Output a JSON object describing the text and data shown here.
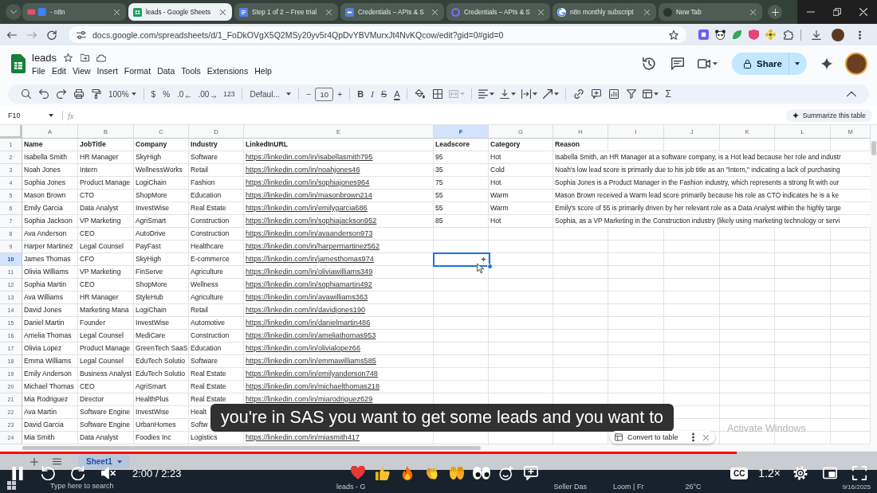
{
  "browser": {
    "tabs": [
      {
        "title": "- n8n",
        "kind": "n8n",
        "selected": false
      },
      {
        "title": "leads - Google Sheets",
        "kind": "sheets",
        "selected": true
      },
      {
        "title": "Step 1 of 2 – Free trial",
        "kind": "page",
        "selected": false
      },
      {
        "title": "Credentials – APIs & S",
        "kind": "api",
        "selected": false
      },
      {
        "title": "Credentials – APIs & S",
        "kind": "ring",
        "selected": false
      },
      {
        "title": "n8n monthly subscript",
        "kind": "google",
        "selected": false
      },
      {
        "title": "New Tab",
        "kind": "blank",
        "selected": false
      }
    ],
    "url": "docs.google.com/spreadsheets/d/1_FoDkOVgX5Q2MSy20yv5r4QpDvYBVMurxJt4NvKQcow/edit?gid=0#gid=0"
  },
  "sheets_header": {
    "title": "leads",
    "menu": [
      "File",
      "Edit",
      "View",
      "Insert",
      "Format",
      "Data",
      "Tools",
      "Extensions",
      "Help"
    ],
    "share": "Share"
  },
  "toolbar": {
    "zoom": "100%",
    "currency": "$",
    "percent": "%",
    "decrease_decimals": ".0",
    "increase_decimals": ".00",
    "number_format": "123",
    "font": "Defaul...",
    "decrease_size": "−",
    "font_size": "10",
    "increase_size": "+",
    "bold": "B",
    "italic": "I",
    "strikethrough": "S",
    "text_color": "A",
    "merge_cells": {
      "disabled": true
    },
    "functions": "Σ"
  },
  "formula_bar": {
    "cell_reference": "F10",
    "function_label": "fx",
    "summarize": "Summarize this table"
  },
  "columns": [
    {
      "label": "A",
      "selected": false
    },
    {
      "label": "B",
      "selected": false
    },
    {
      "label": "C",
      "selected": false
    },
    {
      "label": "D",
      "selected": false
    },
    {
      "label": "E",
      "selected": false
    },
    {
      "label": "F",
      "selected": true
    },
    {
      "label": "G",
      "selected": false
    },
    {
      "label": "H",
      "selected": false
    },
    {
      "label": "I",
      "selected": false
    },
    {
      "label": "J",
      "selected": false
    },
    {
      "label": "K",
      "selected": false
    },
    {
      "label": "L",
      "selected": false
    },
    {
      "label": "M",
      "selected": false
    }
  ],
  "header_row": {
    "number": "1",
    "selected": false,
    "cells": [
      "Name",
      "JobTitle",
      "Company",
      "Industry",
      "LinkedInURL",
      "Leadscore",
      "Category",
      "Reason"
    ]
  },
  "rows": [
    {
      "number": "2",
      "selected": false,
      "name": "Isabella Smith",
      "job_title": "HR Manager",
      "company": "SkyHigh",
      "industry": "Software",
      "linkedin_url": "https://linkedin.com/in/isabellasmith795",
      "leadscore": "95",
      "category": "Hot",
      "reason": "Isabella Smith, an HR Manager at a software company, is a Hot lead because her role and industr"
    },
    {
      "number": "3",
      "selected": false,
      "name": "Noah Jones",
      "job_title": "Intern",
      "company": "WellnessWorks",
      "industry": "Retail",
      "linkedin_url": "https://linkedin.com/in/noahjones46",
      "leadscore": "35",
      "category": "Cold",
      "reason": "Noah's low lead score is primarily due to his job title as an \"Intern,\" indicating a lack of purchasing"
    },
    {
      "number": "4",
      "selected": false,
      "name": "Sophia Jones",
      "job_title": "Product Manage",
      "company": "LogiChain",
      "industry": "Fashion",
      "linkedin_url": "https://linkedin.com/in/sophiajones964",
      "leadscore": "75",
      "category": "Hot",
      "reason": "Sophia Jones is a Product Manager in the Fashion industry, which represents a strong fit with our"
    },
    {
      "number": "5",
      "selected": false,
      "name": "Mason Brown",
      "job_title": "CTO",
      "company": "ShopMore",
      "industry": "Education",
      "linkedin_url": "https://linkedin.com/in/masonbrown214",
      "leadscore": "55",
      "category": "Warm",
      "reason": "Mason Brown received a Warm lead score primarily because his role as CTO indicates he is a ke"
    },
    {
      "number": "6",
      "selected": false,
      "name": "Emily Garcia",
      "job_title": "Data Analyst",
      "company": "InvestWise",
      "industry": "Real Estate",
      "linkedin_url": "https://linkedin.com/in/emilygarcia686",
      "leadscore": "55",
      "category": "Warm",
      "reason": "Emily's score of 55 is primarily driven by her relevant role as a Data Analyst within the highly targe"
    },
    {
      "number": "7",
      "selected": false,
      "name": "Sophia Jackson",
      "job_title": "VP Marketing",
      "company": "AgriSmart",
      "industry": "Construction",
      "linkedin_url": "https://linkedin.com/in/sophiajackson952",
      "leadscore": "85",
      "category": "Hot",
      "reason": "Sophia, as a VP Marketing in the Construction industry (likely using marketing technology or servi"
    },
    {
      "number": "8",
      "selected": false,
      "name": "Ava Anderson",
      "job_title": "CEO",
      "company": "AutoDrive",
      "industry": "Construction",
      "linkedin_url": "https://linkedin.com/in/avaanderson973"
    },
    {
      "number": "9",
      "selected": false,
      "name": "Harper Martinez",
      "job_title": "Legal Counsel",
      "company": "PayFast",
      "industry": "Healthcare",
      "linkedin_url": "https://linkedin.com/in/harpermartinez562"
    },
    {
      "number": "10",
      "selected": true,
      "name": "James Thomas",
      "job_title": "CFO",
      "company": "SkyHigh",
      "industry": "E-commerce",
      "linkedin_url": "https://linkedin.com/in/jamesthomas974"
    },
    {
      "number": "11",
      "selected": false,
      "name": "Olivia Williams",
      "job_title": "VP Marketing",
      "company": "FinServe",
      "industry": "Agriculture",
      "linkedin_url": "https://linkedin.com/in/oliviawilliams349"
    },
    {
      "number": "12",
      "selected": false,
      "name": "Sophia Martin",
      "job_title": "CEO",
      "company": "ShopMore",
      "industry": "Wellness",
      "linkedin_url": "https://linkedin.com/in/sophiamartin492"
    },
    {
      "number": "13",
      "selected": false,
      "name": "Ava Williams",
      "job_title": "HR Manager",
      "company": "StyleHub",
      "industry": "Agriculture",
      "linkedin_url": "https://linkedin.com/in/avawilliams363"
    },
    {
      "number": "14",
      "selected": false,
      "name": "David Jones",
      "job_title": "Marketing Mana",
      "company": "LogiChain",
      "industry": "Retail",
      "linkedin_url": "https://linkedin.com/in/davidjones190"
    },
    {
      "number": "15",
      "selected": false,
      "name": "Daniel Martin",
      "job_title": "Founder",
      "company": "InvestWise",
      "industry": "Automotive",
      "linkedin_url": "https://linkedin.com/in/danielmartin486"
    },
    {
      "number": "16",
      "selected": false,
      "name": "Amelia Thomas",
      "job_title": "Legal Counsel",
      "company": "MediCare",
      "industry": "Construction",
      "linkedin_url": "https://linkedin.com/in/ameliathomas953"
    },
    {
      "number": "17",
      "selected": false,
      "name": "Olivia Lopez",
      "job_title": "Product Manage",
      "company": "GreenTech SaaS",
      "industry": "Education",
      "linkedin_url": "https://linkedin.com/in/olivialopez66"
    },
    {
      "number": "18",
      "selected": false,
      "name": "Emma Williams",
      "job_title": "Legal Counsel",
      "company": "EduTech Solutio",
      "industry": "Software",
      "linkedin_url": "https://linkedin.com/in/emmawilliams585"
    },
    {
      "number": "19",
      "selected": false,
      "name": "Emily Anderson",
      "job_title": "Business Analyst",
      "company": "EduTech Solutio",
      "industry": "Real Estate",
      "linkedin_url": "https://linkedin.com/in/emilyanderson748"
    },
    {
      "number": "20",
      "selected": false,
      "name": "Michael Thomas",
      "job_title": "CEO",
      "company": "AgriSmart",
      "industry": "Real Estate",
      "linkedin_url": "https://linkedin.com/in/michaelthomas218"
    },
    {
      "number": "21",
      "selected": false,
      "name": "Mia Rodriguez",
      "job_title": "Director",
      "company": "HealthPlus",
      "industry": "Real Estate",
      "linkedin_url": "https://linkedin.com/in/miarodriguez629"
    },
    {
      "number": "22",
      "selected": false,
      "name": "Ava Martin",
      "job_title": "Software Engine",
      "company": "InvestWise",
      "industry": "Healt"
    },
    {
      "number": "23",
      "selected": false,
      "name": "David Garcia",
      "job_title": "Software Engine",
      "company": "UrbanHomes",
      "industry": "Softw"
    },
    {
      "number": "24",
      "selected": false,
      "name": "Mia Smith",
      "job_title": "Data Analyst",
      "company": "Foodies Inc",
      "industry": "Logistics",
      "linkedin_url": "https://linkedin.com/in/miasmith417"
    }
  ],
  "table_suggestion": "Convert to table",
  "activation_notice": "Activate Windows",
  "sheet_tabs": [
    {
      "label": "Sheet1",
      "selected": true
    }
  ],
  "taskbar": {
    "search_placeholder": "Type here to search",
    "items": [
      "leads - G",
      "Seller Das",
      "Loom | Fr"
    ],
    "weather": "26°C",
    "date": "9/16/2025"
  },
  "video": {
    "subtitle": "you're in SAS you want to get some leads and you want to",
    "playing": true,
    "muted": true,
    "progress": {
      "level": 0.84
    },
    "time": "2:00 / 2:23",
    "captions": {
      "label": "CC",
      "on": true
    },
    "speed": "1.2×"
  }
}
